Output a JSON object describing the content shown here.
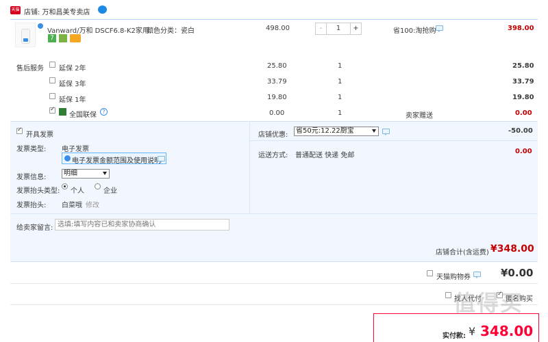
{
  "shop": {
    "badge": "天猫",
    "label": "店铺: 万和昌美专卖店"
  },
  "product": {
    "name": "Vanward/万和 DSCF6.8-K2家用...",
    "attr": "颜色分类：瓷白",
    "unit_price": "498.00",
    "qty": "1",
    "qty_minus": "-",
    "qty_plus": "+",
    "discount": "省100:淘抢购",
    "subtotal": "398.00",
    "badges": [
      "7",
      "",
      ""
    ]
  },
  "service": {
    "label": "售后服务",
    "items": [
      {
        "name": "延保 2年",
        "price": "25.80",
        "qty": "1",
        "note": "",
        "total": "25.80",
        "checked": false
      },
      {
        "name": "延保 3年",
        "price": "33.79",
        "qty": "1",
        "note": "",
        "total": "33.79",
        "checked": false
      },
      {
        "name": "延保 1年",
        "price": "19.80",
        "qty": "1",
        "note": "",
        "total": "19.80",
        "checked": false
      },
      {
        "name": "全国联保",
        "price": "0.00",
        "qty": "1",
        "note": "卖家赠送",
        "total": "0.00",
        "checked": true
      }
    ]
  },
  "invoice": {
    "open_label": "开具发票",
    "type_label": "发票类型:",
    "type_value": "电子发票",
    "info_link": "电子发票金额范围及使用说明",
    "detail_label": "发票信息:",
    "detail_value": "明细",
    "title_type_label": "发票抬头类型:",
    "title_type_personal": "个人",
    "title_type_company": "企业",
    "title_label": "发票抬头:",
    "title_value": "白菜哦",
    "edit_link": "修改"
  },
  "discount": {
    "label": "店铺优惠:",
    "selected": "省50元:12.22厨宝",
    "amount": "-50.00"
  },
  "shipping": {
    "label": "运送方式:",
    "value": "普通配送 快递 免邮",
    "amount": "0.00"
  },
  "message": {
    "label": "给卖家留言:",
    "placeholder": "选填:填写内容已和卖家协商确认"
  },
  "shop_total": {
    "label": "店铺合计(含运费)",
    "value": "¥348.00"
  },
  "tmall_coupon": {
    "label": "天猫购物券",
    "value": "¥0.00"
  },
  "options": {
    "proxy_pay": "找人代付",
    "anonymous": "匿名购买"
  },
  "actual_pay": {
    "label": "实付款:",
    "currency": "¥",
    "value": "348.00"
  },
  "watermark": "值得买"
}
